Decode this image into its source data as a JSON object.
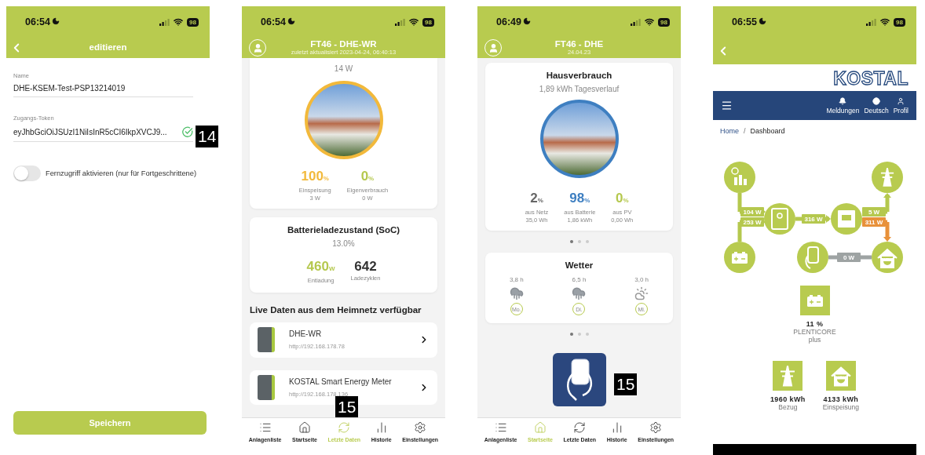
{
  "screens": [
    {
      "kind": "edit",
      "status": {
        "time": "06:54",
        "battery": "98"
      },
      "header": {
        "title": "editieren"
      },
      "fields": [
        {
          "label": "Name",
          "value": "DHE-KSEM-Test-PSP13214019",
          "verified": false
        },
        {
          "label": "Zugangs-Token",
          "value": "eyJhbGciOiJSUzI1NiIsInR5cCI6IkpXVCJ9...",
          "verified": true
        }
      ],
      "toggle": {
        "label": "Fernzugriff aktivieren (nur für Fortgeschrittene)",
        "on": false
      },
      "save_button": "Speichern",
      "callout": "14"
    },
    {
      "kind": "live",
      "status": {
        "time": "06:54",
        "battery": "98"
      },
      "header": {
        "title": "FT46 - DHE-WR",
        "subtitle": "zuletzt aktualisiert 2023-04-24, 06:40:13"
      },
      "photo_card": {
        "reading": "14 W",
        "stats": [
          {
            "value": "100",
            "unit": "%",
            "label": "Einspeisung",
            "sub": "3 W",
            "color": "#f2b93b"
          },
          {
            "value": "0",
            "unit": "%",
            "label": "Eigenverbrauch",
            "sub": "0 W",
            "color": "#b5c84e"
          }
        ]
      },
      "soc_card": {
        "title": "Batterieladezustand (SoC)",
        "subtitle": "13.0%",
        "stats": [
          {
            "value": "460",
            "unit": "W",
            "label": "Entladung",
            "color": "#b5c84e"
          },
          {
            "value": "642",
            "label": "Ladezyklen",
            "color": "#333333"
          }
        ]
      },
      "section_title": "Live Daten aus dem Heimnetz verfügbar",
      "devices": [
        {
          "name": "DHE-WR",
          "url": "http://192.168.178.78"
        },
        {
          "name": "KOSTAL Smart Energy Meter",
          "url": "http://192.168.178.136"
        }
      ],
      "callout": "15",
      "tabs": [
        {
          "kind": "list",
          "label": "Anlagenliste",
          "selected": false
        },
        {
          "kind": "home",
          "label": "Startseite",
          "selected": false
        },
        {
          "kind": "sync",
          "label": "Letzte Daten",
          "selected": true
        },
        {
          "kind": "history",
          "label": "Historie",
          "selected": false
        },
        {
          "kind": "settings",
          "label": "Einstellungen",
          "selected": false
        }
      ]
    },
    {
      "kind": "home",
      "status": {
        "time": "06:49",
        "battery": "98"
      },
      "header": {
        "title": "FT46 - DHE",
        "subtitle": "24.04.23"
      },
      "photo_card": {
        "title": "Hausverbrauch",
        "subtitle": "1,89 kWh Tagesverlauf",
        "stats": [
          {
            "value": "2",
            "unit": "%",
            "label": "aus Netz",
            "sub": "35,0 Wh",
            "color": "#666666"
          },
          {
            "value": "98",
            "unit": "%",
            "label": "aus Batterie",
            "sub": "1,86 kWh",
            "color": "#3e7fc1"
          },
          {
            "value": "0",
            "unit": "%",
            "label": "aus PV",
            "sub": "0,00 Wh",
            "color": "#b5c84e"
          }
        ]
      },
      "pager_dots": [
        {
          "selected": true
        },
        {
          "selected": false
        },
        {
          "selected": false
        }
      ],
      "weather": {
        "title": "Wetter",
        "days": [
          {
            "kind": "rain",
            "hours": "3,8 h",
            "day": "Mo."
          },
          {
            "kind": "rain",
            "hours": "6,5 h",
            "day": "Di."
          },
          {
            "kind": "sun-cloud",
            "hours": "3,0 h",
            "day": "Mi."
          }
        ]
      },
      "weather_dots": [
        {
          "selected": true
        },
        {
          "selected": false
        },
        {
          "selected": false
        }
      ],
      "callout": "15",
      "tabs": [
        {
          "kind": "list",
          "label": "Anlagenliste",
          "selected": false
        },
        {
          "kind": "home",
          "label": "Startseite",
          "selected": true
        },
        {
          "kind": "sync",
          "label": "Letzte Daten",
          "selected": false
        },
        {
          "kind": "history",
          "label": "Historie",
          "selected": false
        },
        {
          "kind": "settings",
          "label": "Einstellungen",
          "selected": false
        }
      ]
    },
    {
      "kind": "web",
      "status": {
        "time": "06:55",
        "battery": "98"
      },
      "logo": "KOSTAL",
      "nav": [
        {
          "kind": "bell",
          "label": "Meldungen"
        },
        {
          "kind": "globe",
          "label": "Deutsch"
        },
        {
          "kind": "user",
          "label": "Profil"
        }
      ],
      "breadcrumb": {
        "items": [
          "Home",
          "Dashboard"
        ],
        "separator": "/"
      },
      "flow": [
        {
          "kind": "pv",
          "value": "104 W",
          "color": "#b5c84e"
        },
        {
          "kind": "battery",
          "value": "253 W",
          "color": "#b5c84e"
        },
        {
          "kind": "inverter",
          "value": "316 W",
          "color": "#b5c84e"
        },
        {
          "kind": "grid",
          "value": "5 W",
          "color": "#b5c84e"
        },
        {
          "kind": "house",
          "value": "311 W",
          "color": "#e8913a"
        },
        {
          "kind": "wallbox",
          "value": "0 W",
          "color": "#9ea3a3"
        }
      ],
      "battery": {
        "percent": "11 %",
        "name": "PLENTICORE",
        "model": "plus"
      },
      "totals": [
        {
          "kind": "grid",
          "value": "1960 kWh",
          "label": "Bezug"
        },
        {
          "kind": "house",
          "value": "4133 kWh",
          "label": "Einspeisung"
        }
      ]
    }
  ]
}
